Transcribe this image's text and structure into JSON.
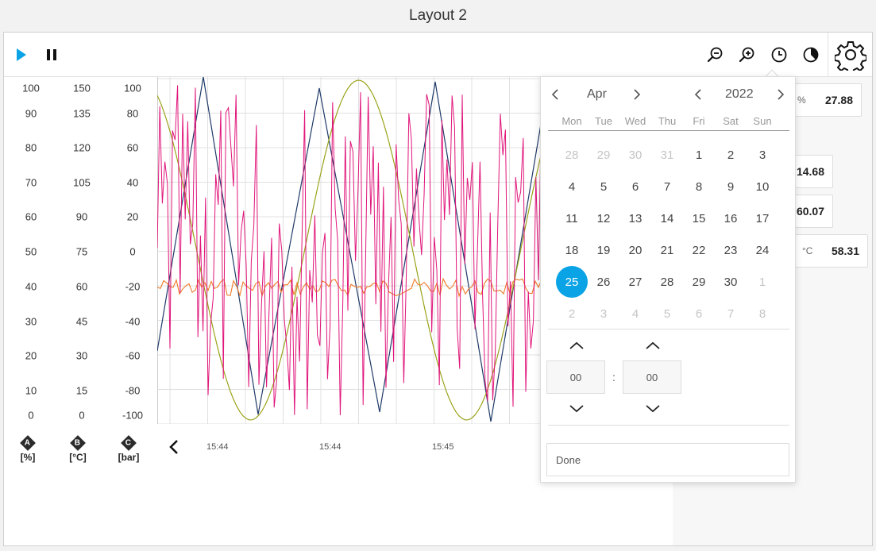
{
  "window": {
    "title": "Layout 2"
  },
  "toolbar": {
    "play_icon": "play-icon",
    "pause_icon": "pause-icon",
    "zoom_out_icon": "zoom-out-icon",
    "zoom_in_icon": "zoom-in-icon",
    "clock_icon": "clock-icon",
    "history_icon": "history-clock-icon",
    "settings_icon": "gear-icon",
    "accent_color": "#0aa3e6"
  },
  "axes": [
    {
      "label": "A",
      "unit": "[%]",
      "ticks": [
        "100",
        "90",
        "80",
        "70",
        "60",
        "50",
        "40",
        "30",
        "20",
        "10",
        "0"
      ]
    },
    {
      "label": "B",
      "unit": "[°C]",
      "ticks": [
        "150",
        "135",
        "120",
        "105",
        "90",
        "75",
        "60",
        "45",
        "30",
        "15",
        "0"
      ]
    },
    {
      "label": "C",
      "unit": "[bar]",
      "ticks": [
        "100",
        "80",
        "60",
        "40",
        "20",
        "0",
        "-20",
        "-40",
        "-60",
        "-80",
        "-100"
      ]
    }
  ],
  "time_axis": {
    "labels": [
      "15:44",
      "15:44",
      "15:45"
    ]
  },
  "series_colors": {
    "navy": "#1f3a68",
    "olive": "#9aa31a",
    "magenta": "#e0157a",
    "orange": "#f07a2a"
  },
  "values": [
    {
      "unit": "%",
      "value": "27.88"
    },
    {
      "unit": "",
      "value": "14.68"
    },
    {
      "unit": "",
      "value": "60.07"
    },
    {
      "unit": "°C",
      "value": "58.31"
    }
  ],
  "datepicker": {
    "month": "Apr",
    "year": "2022",
    "weekdays": [
      "Mon",
      "Tue",
      "Wed",
      "Thu",
      "Fri",
      "Sat",
      "Sun"
    ],
    "days": [
      [
        "28",
        "29",
        "30",
        "31",
        "1",
        "2",
        "3"
      ],
      [
        "4",
        "5",
        "6",
        "7",
        "8",
        "9",
        "10"
      ],
      [
        "11",
        "12",
        "13",
        "14",
        "15",
        "16",
        "17"
      ],
      [
        "18",
        "19",
        "20",
        "21",
        "22",
        "23",
        "24"
      ],
      [
        "25",
        "26",
        "27",
        "28",
        "29",
        "30",
        "1"
      ],
      [
        "2",
        "3",
        "4",
        "5",
        "6",
        "7",
        "8"
      ]
    ],
    "selected_day": "25",
    "hour": "00",
    "minute": "00",
    "separator": ":",
    "done_label": "Done"
  }
}
